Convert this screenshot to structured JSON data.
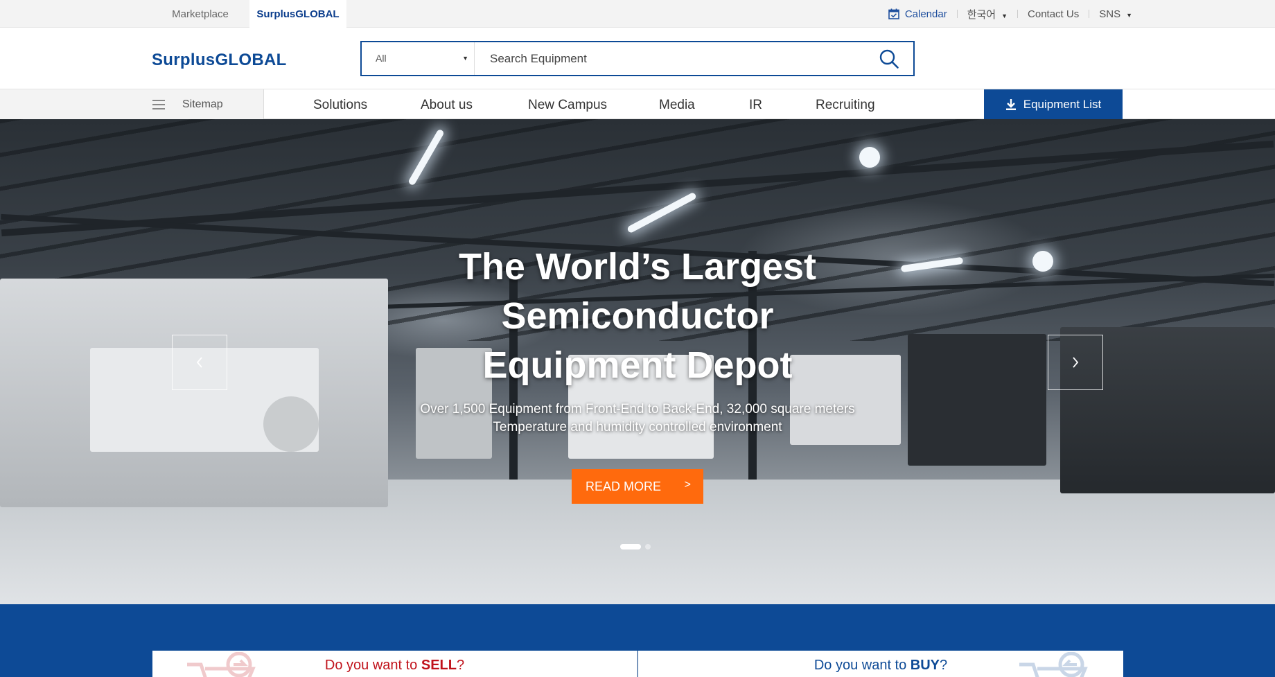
{
  "topbar": {
    "tabs": [
      {
        "label": "Marketplace"
      },
      {
        "label": "SurplusGLOBAL"
      }
    ],
    "calendar": "Calendar",
    "language": "한국어",
    "contact": "Contact Us",
    "sns": "SNS"
  },
  "header": {
    "logo": "SurplusGLOBAL",
    "search": {
      "category": "All",
      "placeholder": "Search Equipment"
    }
  },
  "nav": {
    "sitemap": "Sitemap",
    "items": [
      "Solutions",
      "About us",
      "New Campus",
      "Media",
      "IR",
      "Recruiting"
    ],
    "equipment_list": "Equipment List"
  },
  "hero": {
    "title_lines": [
      "The World’s Largest",
      "Semiconductor",
      "Equipment Depot"
    ],
    "sub_lines": [
      "Over 1,500 Equipment from Front-End to Back-End, 32,000 square meters",
      "Temperature and humidity controlled environment"
    ],
    "cta": "READ MORE",
    "slides_total": 2,
    "active_slide": 1
  },
  "band": {
    "sell": {
      "prefix": "Do you want to ",
      "strong": "SELL",
      "suffix": "?"
    },
    "buy": {
      "prefix": "Do you want to ",
      "strong": "BUY",
      "suffix": "?"
    }
  },
  "colors": {
    "brand_blue": "#0d4a96",
    "cta_orange": "#ff6a0d",
    "sell_red": "#c0111a"
  }
}
